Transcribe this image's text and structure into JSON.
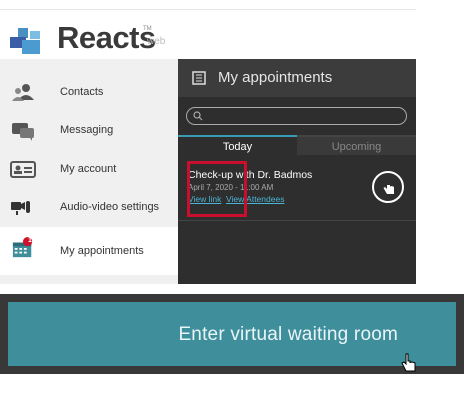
{
  "header": {
    "brand": "Reacts",
    "trademark": "TM",
    "brand_suffix": "web",
    "logo_icon": "reacts-logo-icon"
  },
  "sidebar": {
    "items": [
      {
        "label": "Contacts",
        "icon": "contacts-icon"
      },
      {
        "label": "Messaging",
        "icon": "messaging-icon"
      },
      {
        "label": "My account",
        "icon": "account-card-icon"
      },
      {
        "label": "Audio-video settings",
        "icon": "audio-video-icon"
      },
      {
        "label": "My appointments",
        "icon": "calendar-icon",
        "badge": "1",
        "active": true
      }
    ]
  },
  "panel": {
    "title": "My appointments",
    "search_placeholder": "",
    "tabs": [
      {
        "label": "Today",
        "active": true
      },
      {
        "label": "Upcoming",
        "active": false
      }
    ],
    "appointment": {
      "title": "Check-up with Dr. Badmos",
      "time": "April 7, 2020 - 11:00 AM",
      "view_link": "View link",
      "attendees_link": "View Attendees"
    }
  },
  "cta": {
    "label": "Enter virtual waiting room"
  },
  "colors": {
    "accent": "#3a9bb5",
    "cta_bg": "#3e8e9c",
    "highlight": "#c8102e",
    "panel_bg": "#2e2e2e"
  }
}
